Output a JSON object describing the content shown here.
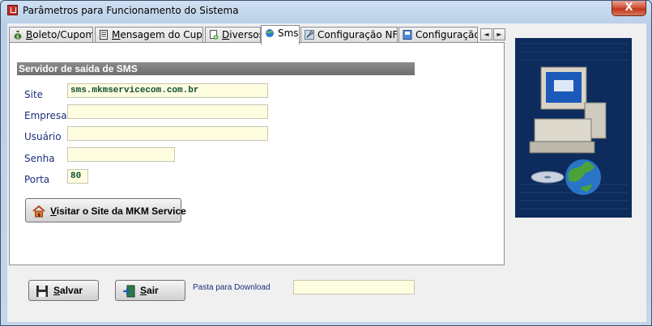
{
  "window": {
    "title": "Parâmetros para Funcionamento do Sistema",
    "close_glyph": "X"
  },
  "tabs": [
    {
      "label_u": "B",
      "label_rest": "oleto/Cupom",
      "icon": "money-bag-icon"
    },
    {
      "label_u": "M",
      "label_rest": "ensagem do Cupom",
      "icon": "document-icon"
    },
    {
      "label_u": "D",
      "label_rest": "iversos",
      "icon": "page-add-icon"
    },
    {
      "label_u": "",
      "label_rest": "Sms",
      "icon": "globe-icon",
      "active": true
    },
    {
      "label_u": "",
      "label_rest": "Configuração NF-e",
      "icon": "wrench-icon"
    },
    {
      "label_u": "",
      "label_rest": "Configuração de",
      "icon": "notebook-icon"
    }
  ],
  "tab_scroll": {
    "left": "◄",
    "right": "►"
  },
  "sms": {
    "section_title": "Servidor de saída de SMS",
    "site_label": "Site",
    "site_value": "sms.mkmservicecom.com.br",
    "empresa_label": "Empresa",
    "empresa_value": "",
    "usuario_label": "Usuário",
    "usuario_value": "",
    "senha_label": "Senha",
    "senha_value": "",
    "porta_label": "Porta",
    "porta_value": "80",
    "visit_button_u": "V",
    "visit_button_rest": "isitar o Site da MKM Service"
  },
  "footer": {
    "save_u": "S",
    "save_rest": "alvar",
    "exit_u": "S",
    "exit_rest": "air",
    "download_label": "Pasta para Download",
    "download_value": ""
  },
  "colors": {
    "label_blue": "#1b2f7a",
    "field_yellow": "#fefde0",
    "header_gray": "#7a7a7a"
  }
}
